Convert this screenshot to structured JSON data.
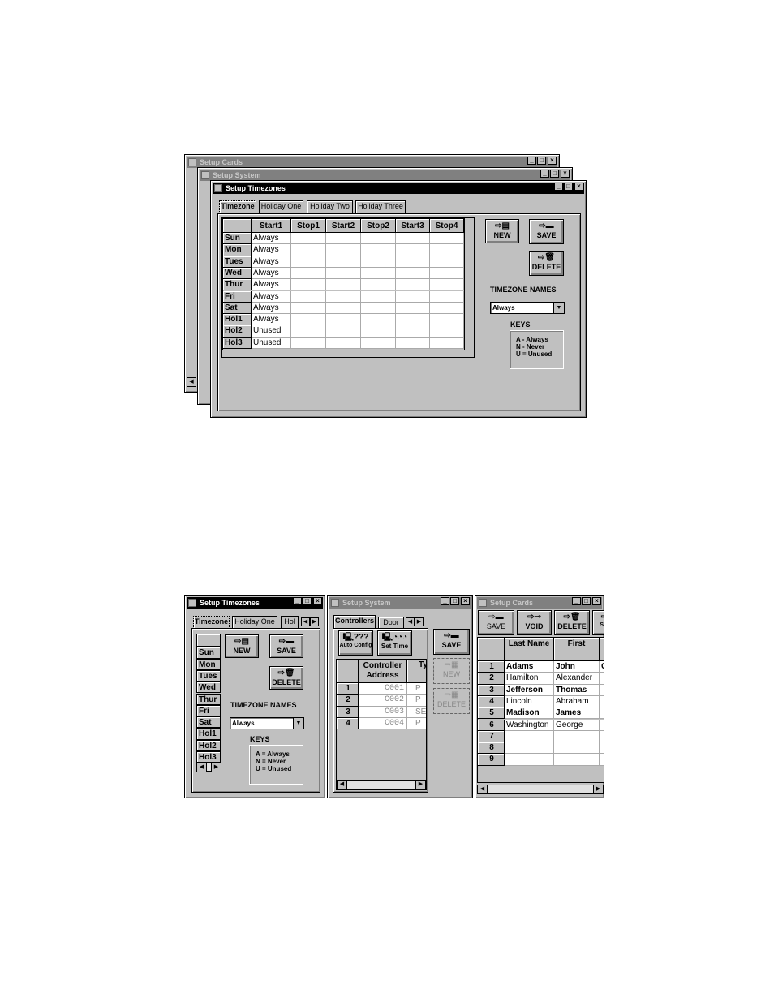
{
  "figure_top": {
    "back_windows": [
      {
        "title": "Setup Cards",
        "icon": "key-icon"
      },
      {
        "title": "Setup System",
        "icon": "computer-icon"
      }
    ],
    "timezones": {
      "title": "Setup Timezones",
      "tabs": [
        "Timezone",
        "Holiday One",
        "Holiday Two",
        "Holiday Three"
      ],
      "columns": [
        "Start1",
        "Stop1",
        "Start2",
        "Stop2",
        "Start3",
        "Stop4"
      ],
      "rows": [
        {
          "label": "Sun",
          "values": [
            "Always",
            "",
            "",
            "",
            "",
            ""
          ]
        },
        {
          "label": "Mon",
          "values": [
            "Always",
            "",
            "",
            "",
            "",
            ""
          ]
        },
        {
          "label": "Tues",
          "values": [
            "Always",
            "",
            "",
            "",
            "",
            ""
          ]
        },
        {
          "label": "Wed",
          "values": [
            "Always",
            "",
            "",
            "",
            "",
            ""
          ]
        },
        {
          "label": "Thur",
          "values": [
            "Always",
            "",
            "",
            "",
            "",
            ""
          ]
        },
        {
          "label": "Fri",
          "values": [
            "Always",
            "",
            "",
            "",
            "",
            ""
          ]
        },
        {
          "label": "Sat",
          "values": [
            "Always",
            "",
            "",
            "",
            "",
            ""
          ]
        },
        {
          "label": "Hol1",
          "values": [
            "Always",
            "",
            "",
            "",
            "",
            ""
          ]
        },
        {
          "label": "Hol2",
          "values": [
            "Unused",
            "",
            "",
            "",
            "",
            ""
          ]
        },
        {
          "label": "Hol3",
          "values": [
            "Unused",
            "",
            "",
            "",
            "",
            ""
          ]
        }
      ],
      "buttons": {
        "new": "NEW",
        "save": "SAVE",
        "delete": "DELETE"
      },
      "names_label": "TIMEZONE NAMES",
      "names_value": "Always",
      "keys_label": "KEYS",
      "keys": [
        "A - Always",
        "N - Never",
        "U = Unused"
      ]
    }
  },
  "figure_bottom": {
    "timezones": {
      "title": "Setup Timezones",
      "tabs": [
        "Timezone",
        "Holiday One",
        "Hol"
      ],
      "rows": [
        "",
        "Sun",
        "Mon",
        "Tues",
        "Wed",
        "Thur",
        "Fri",
        "Sat",
        "Hol1",
        "Hol2",
        "Hol3"
      ],
      "buttons": {
        "new": "NEW",
        "save": "SAVE",
        "delete": "DELETE"
      },
      "names_label": "TIMEZONE NAMES",
      "names_value": "Always",
      "keys_label": "KEYS",
      "keys": [
        "A = Always",
        "N = Never",
        "U = Unused"
      ]
    },
    "system": {
      "title": "Setup System",
      "tabs": [
        "Controllers",
        "Door"
      ],
      "buttons": {
        "auto_config": "Auto Config",
        "set_time": "Set Time",
        "save": "SAVE",
        "new": "NEW",
        "delete": "DELETE"
      },
      "columns": [
        "Controller Address",
        "Ty"
      ],
      "rows": [
        {
          "num": "1",
          "values": [
            "C001",
            "P"
          ]
        },
        {
          "num": "2",
          "values": [
            "C002",
            "P"
          ]
        },
        {
          "num": "3",
          "values": [
            "C003",
            "SE"
          ]
        },
        {
          "num": "4",
          "values": [
            "C004",
            "P"
          ]
        }
      ]
    },
    "cards": {
      "title": "Setup Cards",
      "buttons": {
        "save": "SAVE",
        "void": "VOID",
        "delete": "DELETE",
        "partial": "S E"
      },
      "columns": [
        "Last Name",
        "First",
        "M"
      ],
      "rows": [
        {
          "num": "1",
          "values": [
            "Adams",
            "John",
            "Qu"
          ]
        },
        {
          "num": "2",
          "values": [
            "Hamilton",
            "Alexander",
            ""
          ]
        },
        {
          "num": "3",
          "values": [
            "Jefferson",
            "Thomas",
            ""
          ]
        },
        {
          "num": "4",
          "values": [
            "Lincoln",
            "Abraham",
            ""
          ]
        },
        {
          "num": "5",
          "values": [
            "Madison",
            "James",
            ""
          ]
        },
        {
          "num": "6",
          "values": [
            "Washington",
            "George",
            ""
          ]
        },
        {
          "num": "7",
          "values": [
            "",
            "",
            ""
          ]
        },
        {
          "num": "8",
          "values": [
            "",
            "",
            ""
          ]
        },
        {
          "num": "9",
          "values": [
            "",
            "",
            ""
          ]
        }
      ]
    }
  }
}
